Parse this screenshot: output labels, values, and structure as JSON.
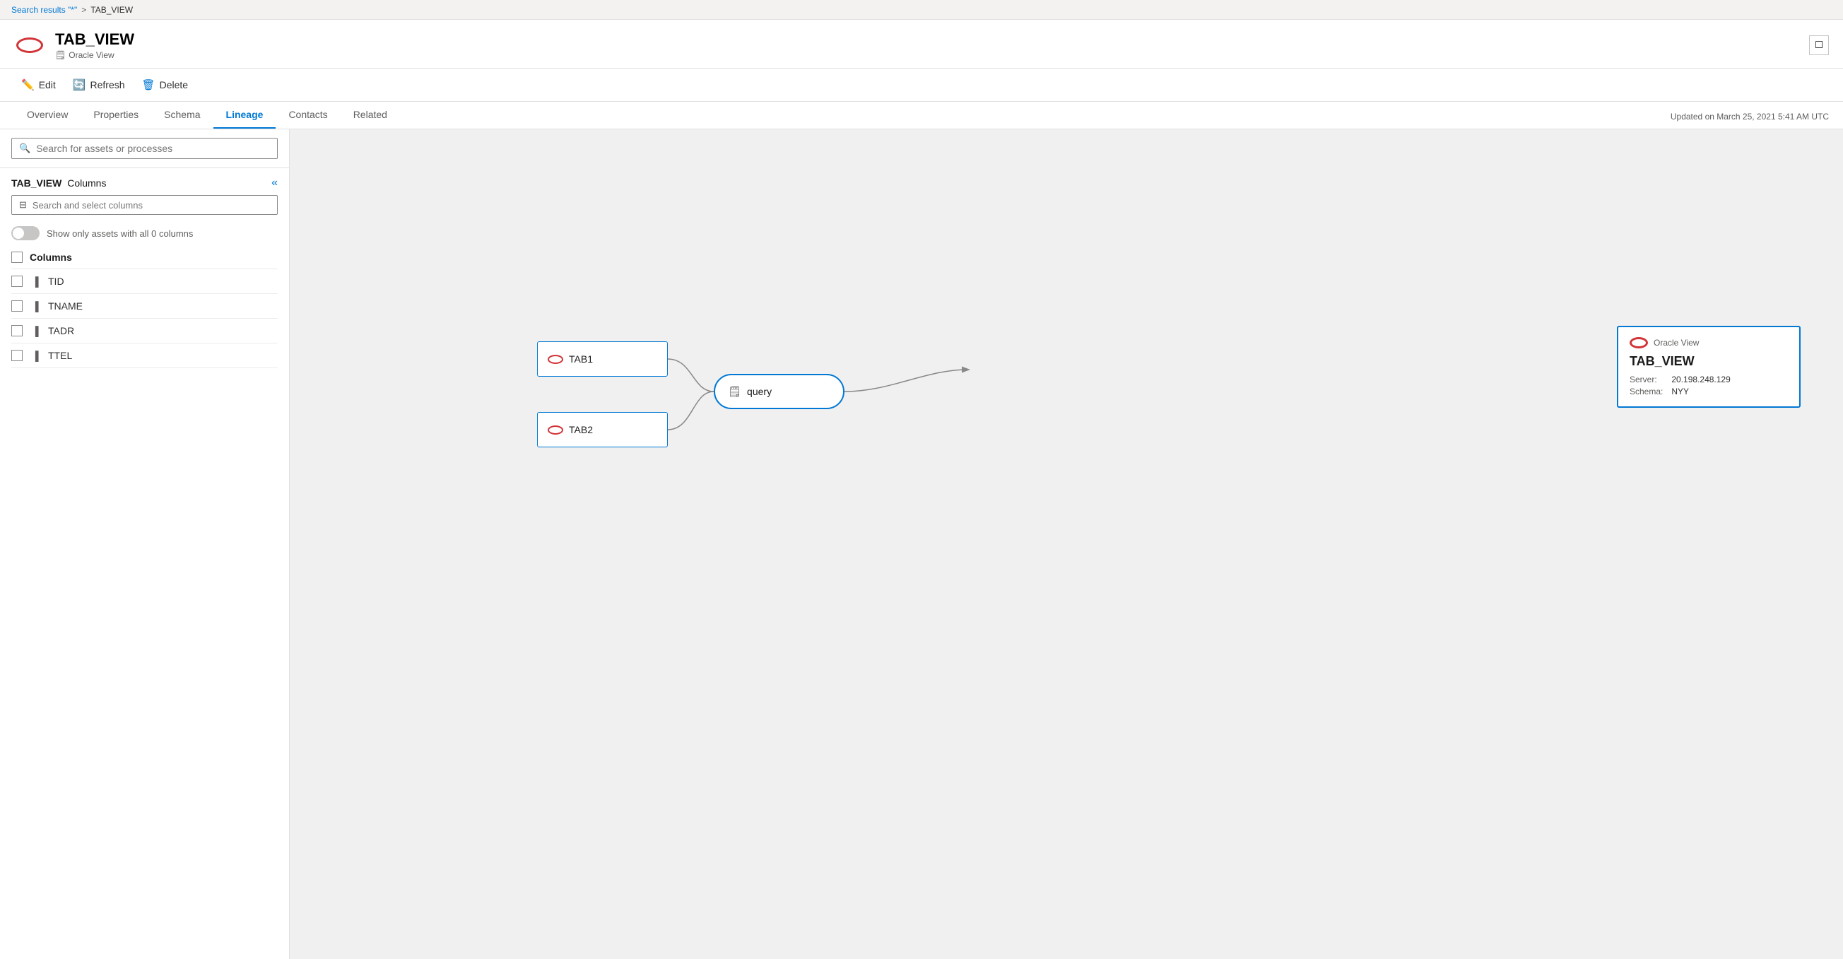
{
  "breadcrumb": {
    "link_text": "Search results \"*\"",
    "separator": ">",
    "current": "TAB_VIEW"
  },
  "header": {
    "title": "TAB_VIEW",
    "subtitle": "Oracle View",
    "subtitle_icon": "📄"
  },
  "toolbar": {
    "edit_label": "Edit",
    "refresh_label": "Refresh",
    "delete_label": "Delete"
  },
  "tabs": {
    "items": [
      {
        "label": "Overview",
        "active": false
      },
      {
        "label": "Properties",
        "active": false
      },
      {
        "label": "Schema",
        "active": false
      },
      {
        "label": "Lineage",
        "active": true
      },
      {
        "label": "Contacts",
        "active": false
      },
      {
        "label": "Related",
        "active": false
      }
    ],
    "meta": "Updated on March 25, 2021 5:41 AM UTC"
  },
  "search_bar": {
    "placeholder": "Search for assets or processes"
  },
  "columns_panel": {
    "entity_name": "TAB_VIEW",
    "label": "Columns",
    "filter_placeholder": "Search and select columns",
    "toggle_label": "Show only assets with all 0 columns",
    "columns_header": "Columns",
    "columns": [
      {
        "name": "TID"
      },
      {
        "name": "TNAME"
      },
      {
        "name": "TADR"
      },
      {
        "name": "TTEL"
      }
    ]
  },
  "lineage": {
    "nodes": {
      "tab1": {
        "label": "TAB1"
      },
      "tab2": {
        "label": "TAB2"
      },
      "query": {
        "label": "query"
      },
      "tabview": {
        "type": "Oracle View",
        "name": "TAB_VIEW",
        "server_label": "Server:",
        "server_value": "20.198.248.129",
        "schema_label": "Schema:",
        "schema_value": "NYY"
      }
    }
  }
}
